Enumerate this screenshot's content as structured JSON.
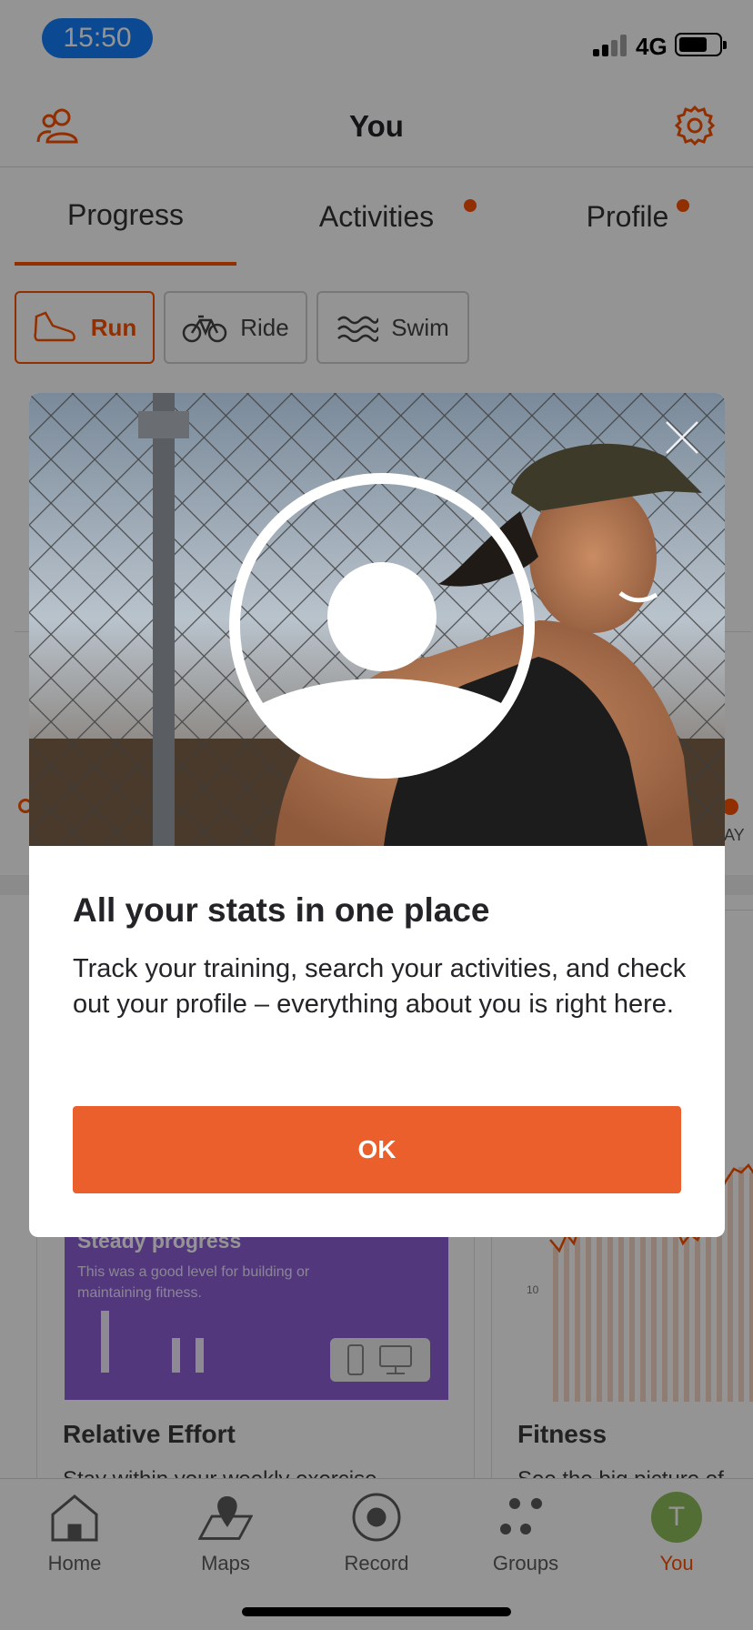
{
  "status_bar": {
    "time": "15:50",
    "network": "4G"
  },
  "header": {
    "title": "You",
    "left_icon": "friends-icon",
    "right_icon": "gear-icon"
  },
  "tabs": [
    {
      "label": "Progress",
      "active": true,
      "dot": false
    },
    {
      "label": "Activities",
      "active": false,
      "dot": true
    },
    {
      "label": "Profile",
      "active": false,
      "dot": true
    }
  ],
  "sport_filters": [
    {
      "label": "Run",
      "icon": "shoe-icon",
      "active": true
    },
    {
      "label": "Ride",
      "icon": "bike-icon",
      "active": false
    },
    {
      "label": "Swim",
      "icon": "waves-icon",
      "active": false
    }
  ],
  "background_partial_text": {
    "day_suffix": "AY"
  },
  "cards": {
    "relative_effort": {
      "panel_title": "Steady progress",
      "panel_text": "This was a good level for building or maintaining fitness.",
      "title": "Relative Effort",
      "subtitle": "Stay within your weekly exercise"
    },
    "fitness": {
      "axis_tick": "10",
      "title": "Fitness",
      "subtitle": "See the big picture of"
    }
  },
  "bottom_nav": [
    {
      "label": "Home",
      "icon": "home-icon",
      "active": false
    },
    {
      "label": "Maps",
      "icon": "map-pin-icon",
      "active": false
    },
    {
      "label": "Record",
      "icon": "record-icon",
      "active": false
    },
    {
      "label": "Groups",
      "icon": "groups-icon",
      "active": false
    },
    {
      "label": "You",
      "icon": "avatar",
      "avatar_initial": "T",
      "active": true
    }
  ],
  "modal": {
    "title": "All your stats in one place",
    "body": "Track your training, search your activities, and check out your profile – everything about you is right here.",
    "ok_label": "OK",
    "close_icon": "close-icon",
    "photo_icon": "profile-icon"
  },
  "colors": {
    "accent": "#fc5200",
    "ok_button": "#ea5f2b",
    "time_pill": "#147efb",
    "purple_panel": "#8e5fd8",
    "avatar": "#8fbd5a"
  }
}
